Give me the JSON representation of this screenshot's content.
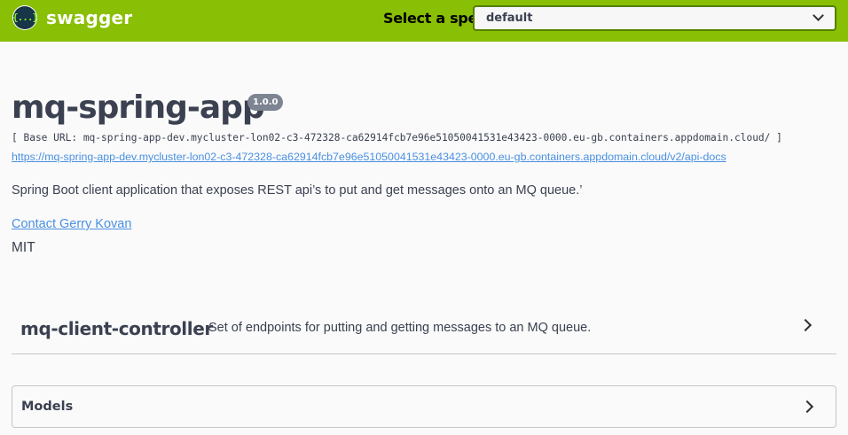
{
  "topbar": {
    "logo_glyph": "{...}",
    "brand": "swagger",
    "spec_label": "Select a spec",
    "spec_selected": "default",
    "color": "#89bf04"
  },
  "info": {
    "title": "mq-spring-app",
    "version": "1.0.0",
    "base_url": "[ Base URL: mq-spring-app-dev.mycluster-lon02-c3-472328-ca62914fcb7e96e51050041531e43423-0000.eu-gb.containers.appdomain.cloud/ ]",
    "api_docs_link": "https://mq-spring-app-dev.mycluster-lon02-c3-472328-ca62914fcb7e96e51050041531e43423-0000.eu-gb.containers.appdomain.cloud/v2/api-docs",
    "description": "Spring Boot client application that exposes REST api’s to put and get messages onto an MQ queue.’",
    "contact": "Contact Gerry Kovan",
    "license": "MIT"
  },
  "tags": [
    {
      "name": "mq-client-controller",
      "description": "Set of endpoints for putting and getting messages to an MQ queue."
    }
  ],
  "models": {
    "label": "Models"
  },
  "icons": {
    "spec_dropdown": "chevron-down-icon",
    "expand": "chevron-right-icon"
  }
}
